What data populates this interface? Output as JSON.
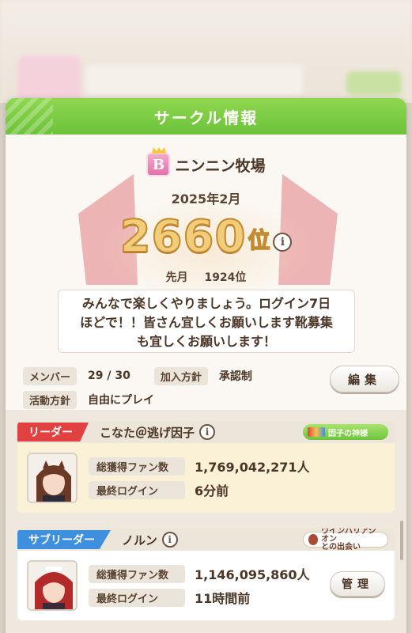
{
  "background": {
    "circle_name": "ニンニン牧場"
  },
  "dialog": {
    "title": "サークル情報"
  },
  "circle": {
    "rank_letter": "B",
    "name": "ニンニン牧場",
    "month": "2025年2月",
    "rank": "2660",
    "rank_suffix": "位",
    "last_month_label": "先月",
    "last_month_rank": "1924位",
    "description_lines": [
      "みんなで楽しくやりましょう。ログイン7日",
      "ほどで！！皆さん宜しくお願いします靴募集",
      "も宜しくお願いします！"
    ]
  },
  "meta": {
    "members_label": "メンバー",
    "members_value": "29 / 30",
    "join_label": "加入方針",
    "join_value": "承認制",
    "activity_label": "活動方針",
    "activity_value": "自由にプレイ",
    "edit_button": "編集"
  },
  "members": [
    {
      "role": "リーダー",
      "name": "こなた＠逃げ因子",
      "title_badge": "因子の神様",
      "fans_label": "総獲得ファン数",
      "fans_value": "1,769,042,271人",
      "login_label": "最終ログイン",
      "login_value": "6分前"
    },
    {
      "role": "サブリーダー",
      "name": "ノルン",
      "title_badge_line1": "ウインバリアシオン",
      "title_badge_line2": "との出会い",
      "fans_label": "総獲得ファン数",
      "fans_value": "1,146,095,860人",
      "login_label": "最終ログイン",
      "login_value": "11時間前",
      "manage_button": "管理"
    }
  ],
  "colors": {
    "header_green": "#6cc23a",
    "leader_red": "#e24141",
    "subleader_blue": "#3f8fdf",
    "rank_gold": "#f1cd7b"
  }
}
